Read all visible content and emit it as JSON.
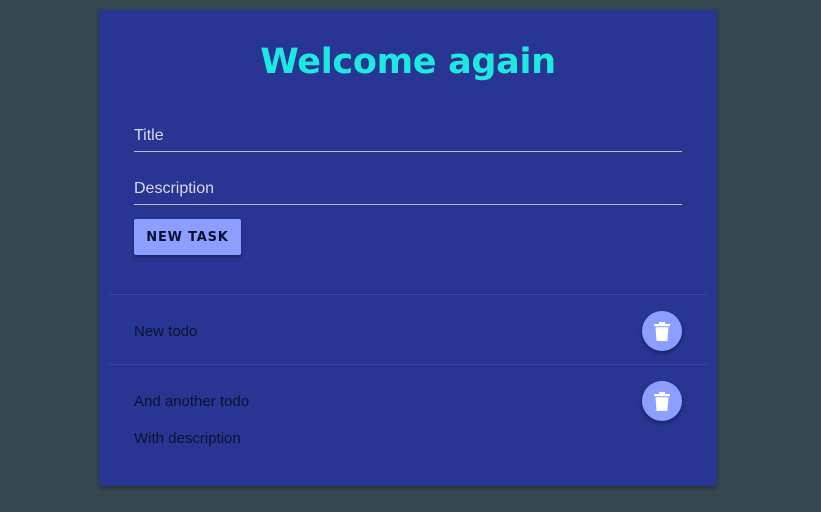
{
  "header": {
    "title": "Welcome again"
  },
  "form": {
    "title_placeholder": "Title",
    "title_value": "",
    "description_placeholder": "Description",
    "description_value": "",
    "submit_label": "NEW TASK"
  },
  "todos": [
    {
      "title": "New todo",
      "description": "",
      "delete_icon": "trash-icon"
    },
    {
      "title": "And another todo",
      "description": "With description",
      "delete_icon": "trash-icon"
    }
  ],
  "colors": {
    "background": "#37474f",
    "card": "#283593",
    "heading": "#1de9e0",
    "accent": "#8c9eff"
  }
}
